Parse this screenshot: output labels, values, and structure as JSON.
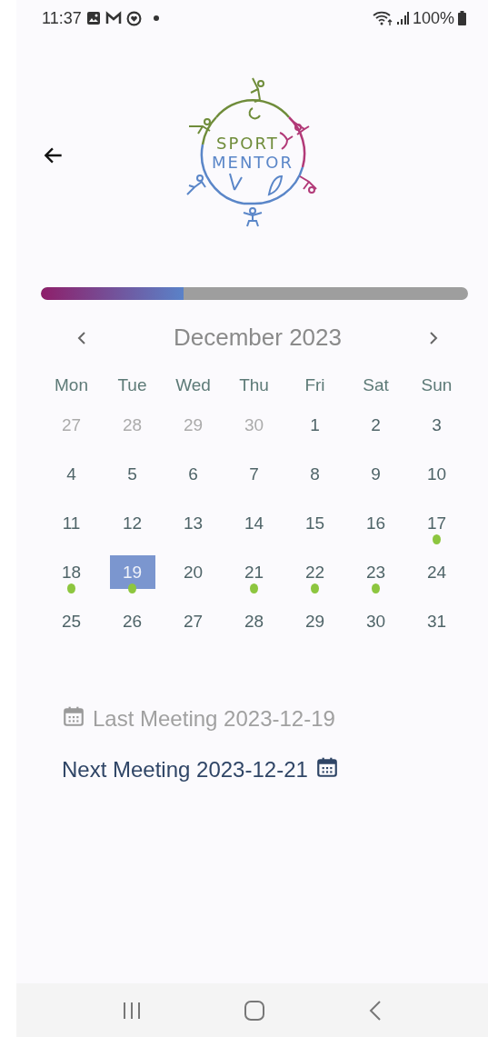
{
  "status_bar": {
    "time": "11:37",
    "battery": "100%"
  },
  "logo": {
    "line_1": "SPORT",
    "line_2": "MENTOR"
  },
  "progress": {
    "level": 0.335
  },
  "calendar": {
    "month": "December 2023",
    "weekdays": [
      "Mon",
      "Tue",
      "Wed",
      "Thu",
      "Fri",
      "Sat",
      "Sun"
    ],
    "weeks": [
      [
        {
          "day": "27",
          "outside": true,
          "selected": false,
          "event": false
        },
        {
          "day": "28",
          "outside": true,
          "selected": false,
          "event": false
        },
        {
          "day": "29",
          "outside": true,
          "selected": false,
          "event": false
        },
        {
          "day": "30",
          "outside": true,
          "selected": false,
          "event": false
        },
        {
          "day": "1",
          "outside": false,
          "selected": false,
          "event": false
        },
        {
          "day": "2",
          "outside": false,
          "selected": false,
          "event": false
        },
        {
          "day": "3",
          "outside": false,
          "selected": false,
          "event": false
        }
      ],
      [
        {
          "day": "4",
          "outside": false,
          "selected": false,
          "event": false
        },
        {
          "day": "5",
          "outside": false,
          "selected": false,
          "event": false
        },
        {
          "day": "6",
          "outside": false,
          "selected": false,
          "event": false
        },
        {
          "day": "7",
          "outside": false,
          "selected": false,
          "event": false
        },
        {
          "day": "8",
          "outside": false,
          "selected": false,
          "event": false
        },
        {
          "day": "9",
          "outside": false,
          "selected": false,
          "event": false
        },
        {
          "day": "10",
          "outside": false,
          "selected": false,
          "event": false
        }
      ],
      [
        {
          "day": "11",
          "outside": false,
          "selected": false,
          "event": false
        },
        {
          "day": "12",
          "outside": false,
          "selected": false,
          "event": false
        },
        {
          "day": "13",
          "outside": false,
          "selected": false,
          "event": false
        },
        {
          "day": "14",
          "outside": false,
          "selected": false,
          "event": false
        },
        {
          "day": "15",
          "outside": false,
          "selected": false,
          "event": false
        },
        {
          "day": "16",
          "outside": false,
          "selected": false,
          "event": false
        },
        {
          "day": "17",
          "outside": false,
          "selected": false,
          "event": true
        }
      ],
      [
        {
          "day": "18",
          "outside": false,
          "selected": false,
          "event": true
        },
        {
          "day": "19",
          "outside": false,
          "selected": true,
          "event": true
        },
        {
          "day": "20",
          "outside": false,
          "selected": false,
          "event": false
        },
        {
          "day": "21",
          "outside": false,
          "selected": false,
          "event": true
        },
        {
          "day": "22",
          "outside": false,
          "selected": false,
          "event": true
        },
        {
          "day": "23",
          "outside": false,
          "selected": false,
          "event": true
        },
        {
          "day": "24",
          "outside": false,
          "selected": false,
          "event": false
        }
      ],
      [
        {
          "day": "25",
          "outside": false,
          "selected": false,
          "event": false
        },
        {
          "day": "26",
          "outside": false,
          "selected": false,
          "event": false
        },
        {
          "day": "27",
          "outside": false,
          "selected": false,
          "event": false
        },
        {
          "day": "28",
          "outside": false,
          "selected": false,
          "event": false
        },
        {
          "day": "29",
          "outside": false,
          "selected": false,
          "event": false
        },
        {
          "day": "30",
          "outside": false,
          "selected": false,
          "event": false
        },
        {
          "day": "31",
          "outside": false,
          "selected": false,
          "event": false
        }
      ]
    ]
  },
  "last_meeting": {
    "label": "Last Meeting",
    "date": "2023-12-19"
  },
  "next_meeting": {
    "label": "Next Meeting",
    "date": "2023-12-21"
  }
}
